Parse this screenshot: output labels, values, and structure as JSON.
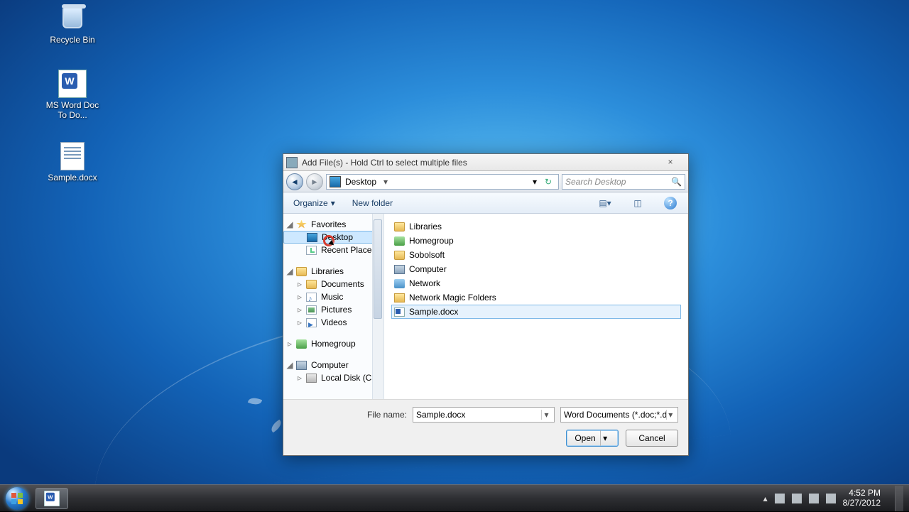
{
  "desktop": {
    "icons": {
      "recycle": "Recycle Bin",
      "wordapp": "MS Word Doc To Do...",
      "sample": "Sample.docx"
    }
  },
  "dialog": {
    "title": "Add File(s) - Hold Ctrl to select multiple files",
    "close": "×",
    "nav": {
      "location": "Desktop",
      "search_placeholder": "Search Desktop",
      "refresh": "↻",
      "dd": "▾",
      "chev": "▸"
    },
    "toolbar": {
      "organize": "Organize",
      "newfolder": "New folder"
    },
    "tree": {
      "favorites": "Favorites",
      "desktop": "Desktop",
      "recent": "Recent Places",
      "libraries": "Libraries",
      "documents": "Documents",
      "music": "Music",
      "pictures": "Pictures",
      "videos": "Videos",
      "homegroup": "Homegroup",
      "computer": "Computer",
      "localdisk": "Local Disk (C:)"
    },
    "files": [
      {
        "name": "Libraries",
        "icon": "ic-fld"
      },
      {
        "name": "Homegroup",
        "icon": "ic-hg"
      },
      {
        "name": "Sobolsoft",
        "icon": "ic-fld"
      },
      {
        "name": "Computer",
        "icon": "ic-cmp"
      },
      {
        "name": "Network",
        "icon": "ic-net"
      },
      {
        "name": "Network Magic Folders",
        "icon": "ic-nmf"
      },
      {
        "name": "Sample.docx",
        "icon": "ic-docx",
        "selected": true
      }
    ],
    "footer": {
      "fn_label": "File name:",
      "fn_value": "Sample.docx",
      "filter": "Word Documents (*.doc;*.docx",
      "open": "Open",
      "cancel": "Cancel"
    }
  },
  "taskbar": {
    "time": "4:52 PM",
    "date": "8/27/2012"
  }
}
